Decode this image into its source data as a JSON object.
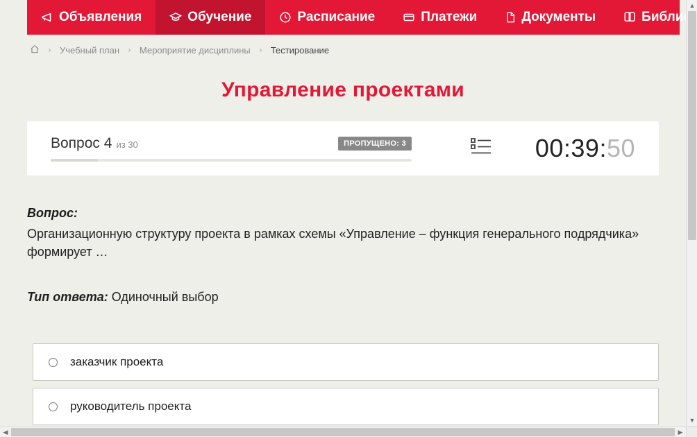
{
  "nav": {
    "items": [
      {
        "label": "Объявления",
        "icon": "megaphone-icon",
        "active": false
      },
      {
        "label": "Обучение",
        "icon": "graduation-icon",
        "active": true
      },
      {
        "label": "Расписание",
        "icon": "clock-icon",
        "active": false
      },
      {
        "label": "Платежи",
        "icon": "card-icon",
        "active": false
      },
      {
        "label": "Документы",
        "icon": "document-icon",
        "active": false
      },
      {
        "label": "Библиотека",
        "icon": "book-icon",
        "active": false,
        "dropdown": true
      }
    ]
  },
  "breadcrumb": {
    "items": [
      {
        "label": "",
        "icon": "home-icon"
      },
      {
        "label": "Учебный план"
      },
      {
        "label": "Мероприятие дисциплины"
      },
      {
        "label": "Тестирование",
        "current": true
      }
    ]
  },
  "page_title": "Управление проектами",
  "status": {
    "question_label": "Вопрос 4",
    "of_text": "из 30",
    "skipped_label": "ПРОПУЩЕНО: 3",
    "progress_percent": 13,
    "timer_main": "00:39:",
    "timer_ms": "50"
  },
  "question": {
    "heading": "Вопрос:",
    "text": "Организационную структуру проекта в рамках схемы «Управление – функция генерального подрядчика» формирует …",
    "answer_type_label": "Тип ответа:",
    "answer_type_value": " Одиночный выбор"
  },
  "answers": [
    {
      "label": "заказчик проекта"
    },
    {
      "label": "руководитель проекта"
    }
  ]
}
